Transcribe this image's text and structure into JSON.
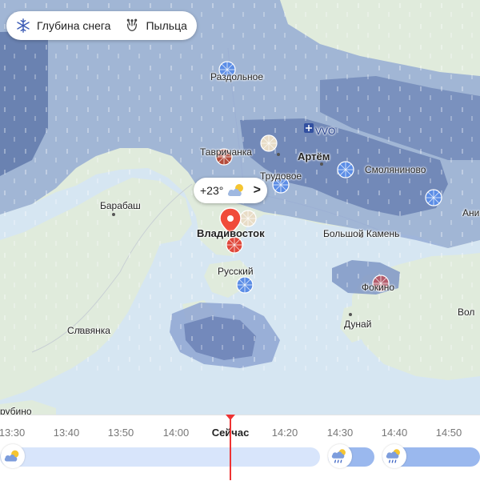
{
  "layers": {
    "snow_depth_label": "Глубина снега",
    "pollen_label": "Пыльца"
  },
  "map": {
    "places": {
      "razdolnoe": "Раздольное",
      "tavrichanka": "Тавричанка",
      "artem": "Артём",
      "vvo": "VVO",
      "trudovoe": "Трудовое",
      "smolyaninovo": "Смоляниново",
      "anis": "Анис",
      "barabash": "Барабаш",
      "vladivostok": "Владивосток",
      "bolshoy_kamen": "Большой Камень",
      "russkiy": "Русский",
      "fokino": "Фокино",
      "dunay": "Дунай",
      "slavyanka": "Славянка",
      "zarubino": "рубино",
      "vol": "Вол"
    },
    "current_weather": {
      "temperature": "+23°",
      "icon": "partly-cloudy-icon",
      "chevron": ">"
    },
    "colors": {
      "precip_light": "#8fa6d4",
      "precip_dark": "#5d76a8",
      "land": "#dfeadb",
      "sea": "#d7e6f2",
      "pin": "#f04b3a"
    }
  },
  "timeline": {
    "ticks": [
      "13:30",
      "13:40",
      "13:50",
      "14:00",
      "Сейчас",
      "14:20",
      "14:30",
      "14:40",
      "14:50"
    ],
    "now_label": "Сейчас",
    "icons": [
      "partly-cloudy-icon",
      "rain-cloud-icon",
      "rain-cloud-icon"
    ]
  }
}
